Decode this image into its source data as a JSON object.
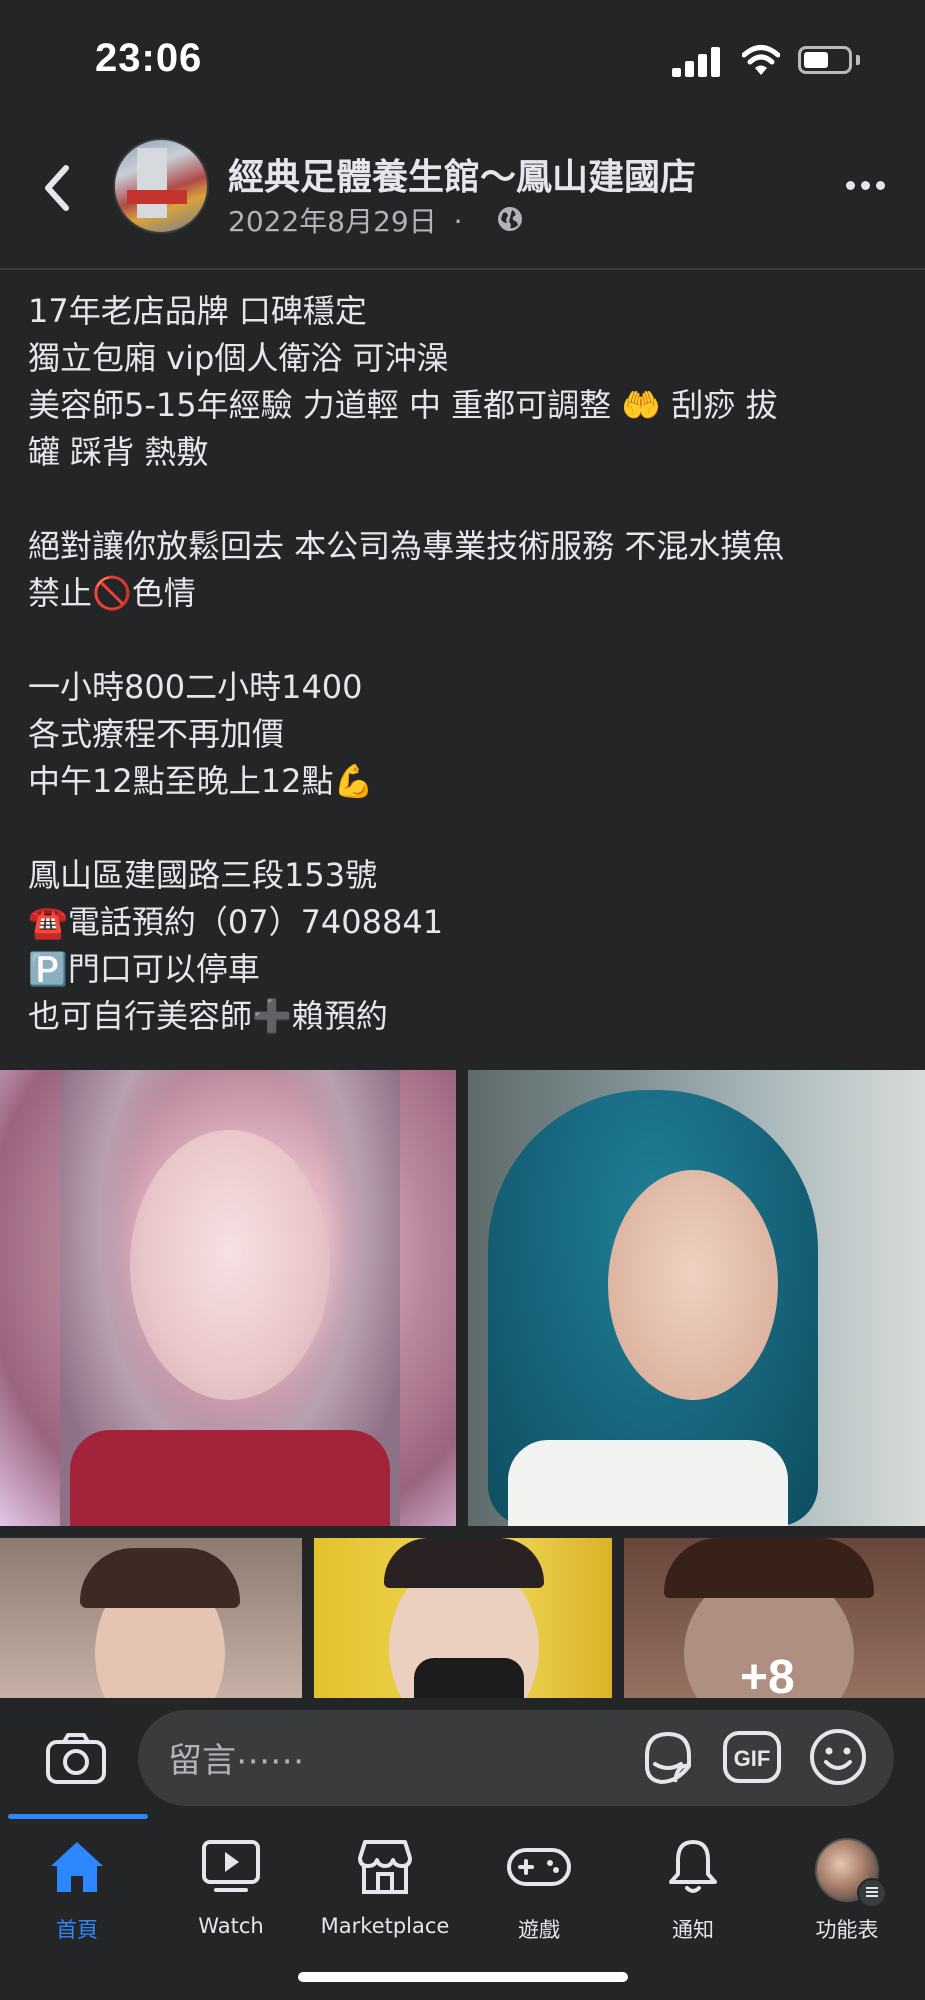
{
  "status_bar": {
    "time": "23:06"
  },
  "post_header": {
    "page_name": "經典足體養生館～鳳山建國店",
    "date": "2022年8月29日",
    "separator": "·"
  },
  "post_body": {
    "lines": [
      "17年老店品牌 口碑穩定",
      "獨立包廂 vip個人衛浴 可沖澡",
      "美容師5-15年經驗 力道輕 中 重都可調整 🤲 刮痧 拔",
      "罐 踩背 熱敷",
      "",
      "絕對讓你放鬆回去 本公司為專業技術服務 不混水摸魚",
      "禁止🚫色情",
      "",
      "一小時800二小時1400",
      "各式療程不再加價",
      "中午12點至晚上12點💪",
      "",
      "鳳山區建國路三段153號",
      "☎️電話預約（07）7408841",
      "🅿️門口可以停車",
      "也可自行美容師➕賴預約"
    ]
  },
  "photos": {
    "more_count": "+8"
  },
  "comment": {
    "placeholder": "留言⋯⋯"
  },
  "tab_bar": {
    "tabs": [
      {
        "label": "首頁",
        "icon": "home-icon",
        "active": true
      },
      {
        "label": "Watch",
        "icon": "watch-icon"
      },
      {
        "label": "Marketplace",
        "icon": "marketplace-icon"
      },
      {
        "label": "遊戲",
        "icon": "gamepad-icon"
      },
      {
        "label": "通知",
        "icon": "bell-icon"
      },
      {
        "label": "功能表",
        "icon": "menu-avatar"
      }
    ]
  },
  "colors": {
    "background": "#242526",
    "accent": "#2d88ff",
    "text": "#e4e6eb",
    "secondary_text": "#b0b3b8"
  }
}
